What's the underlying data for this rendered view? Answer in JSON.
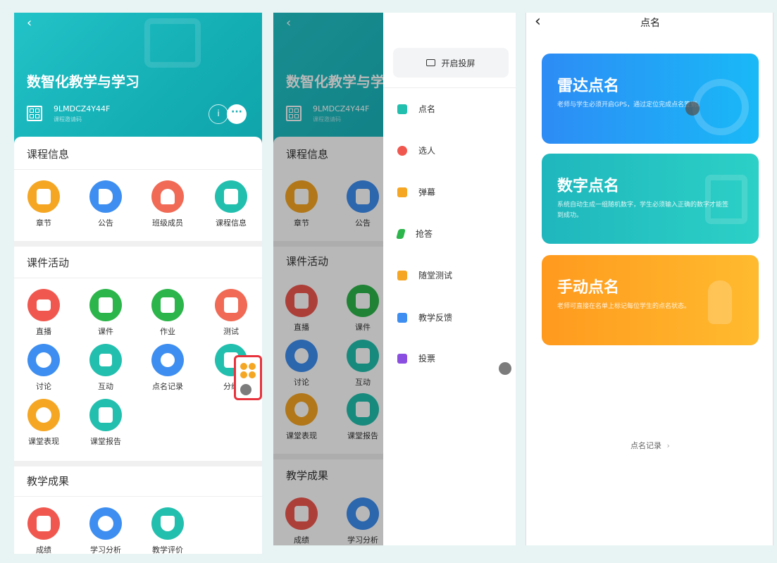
{
  "screen1": {
    "back": "‹",
    "course_title": "数智化教学与学习",
    "course_code": "9LMDCZ4Y44F",
    "course_code_sub": "课程邀请码",
    "sections": {
      "info": {
        "title": "课程信息",
        "items": [
          {
            "label": "章节",
            "color": "#f5a623",
            "icon": "chapter-icon"
          },
          {
            "label": "公告",
            "color": "#3d8ef0",
            "icon": "megaphone-icon"
          },
          {
            "label": "班级成员",
            "color": "#f06a55",
            "icon": "members-icon"
          },
          {
            "label": "课程信息",
            "color": "#22bfae",
            "icon": "course-info-icon"
          }
        ]
      },
      "activity": {
        "title": "课件活动",
        "items": [
          {
            "label": "直播",
            "color": "#f0584f",
            "icon": "live-icon"
          },
          {
            "label": "课件",
            "color": "#2bb54a",
            "icon": "courseware-icon"
          },
          {
            "label": "作业",
            "color": "#2bb54a",
            "icon": "homework-icon"
          },
          {
            "label": "测试",
            "color": "#f06a55",
            "icon": "test-icon"
          },
          {
            "label": "讨论",
            "color": "#3d8ef0",
            "icon": "discussion-icon"
          },
          {
            "label": "互动",
            "color": "#22bfae",
            "icon": "interact-icon"
          },
          {
            "label": "点名记录",
            "color": "#3d8ef0",
            "icon": "rollcall-record-icon"
          },
          {
            "label": "分组",
            "color": "#22bfae",
            "icon": "group-icon"
          },
          {
            "label": "课堂表现",
            "color": "#f5a623",
            "icon": "performance-icon"
          },
          {
            "label": "课堂报告",
            "color": "#22bfae",
            "icon": "report-icon"
          }
        ]
      },
      "results": {
        "title": "教学成果",
        "items": [
          {
            "label": "成绩",
            "color": "#f0584f",
            "icon": "score-icon"
          },
          {
            "label": "学习分析",
            "color": "#3d8ef0",
            "icon": "analysis-icon"
          },
          {
            "label": "教学评价",
            "color": "#22bfae",
            "icon": "evaluation-icon"
          }
        ]
      }
    },
    "floating_button_icon": "apps-grid-icon"
  },
  "screen2": {
    "projection_button": "开启投屏",
    "drawer_items": [
      {
        "label": "点名",
        "icon": "rollcall-icon",
        "color": "#22bfae"
      },
      {
        "label": "选人",
        "icon": "pick-person-icon",
        "color": "#f0584f"
      },
      {
        "label": "弹幕",
        "icon": "danmaku-icon",
        "color": "#f5a623"
      },
      {
        "label": "抢答",
        "icon": "quick-answer-icon",
        "color": "#2bb54a"
      },
      {
        "label": "随堂测试",
        "icon": "quiz-icon",
        "color": "#f5a623"
      },
      {
        "label": "教学反馈",
        "icon": "feedback-icon",
        "color": "#3d8ef0"
      },
      {
        "label": "投票",
        "icon": "vote-icon",
        "color": "#8a4fe0"
      }
    ]
  },
  "screen3": {
    "back": "‹",
    "title": "点名",
    "cards": [
      {
        "title": "雷达点名",
        "desc": "老师与学生必须开启GPS，通过定位完成点名签到。",
        "color_from": "#2d8cf5",
        "color_to": "#19b9f7",
        "icon": "radar-icon"
      },
      {
        "title": "数字点名",
        "desc": "系统自动生成一组随机数字，学生必须输入正确的数字才能签到成功。",
        "color_from": "#1fb7bd",
        "color_to": "#2cd0c6",
        "icon": "number-icon"
      },
      {
        "title": "手动点名",
        "desc": "老师可直接在名单上标记每位学生的点名状态。",
        "color_from": "#ff9a1e",
        "color_to": "#ffbb2f",
        "icon": "hand-icon"
      }
    ],
    "record_link": "点名记录",
    "record_chevron": "›"
  }
}
